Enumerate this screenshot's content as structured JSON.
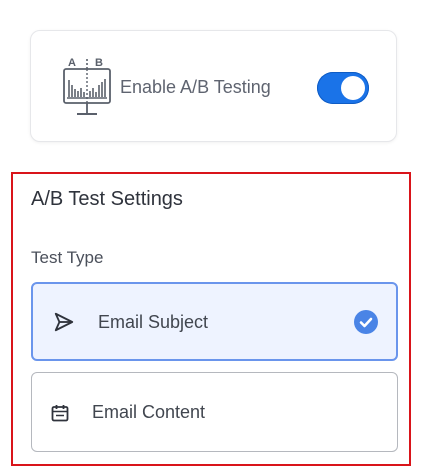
{
  "toggle_card": {
    "icon_letters": [
      "A",
      "B"
    ],
    "label": "Enable A/B Testing",
    "enabled": true,
    "accent_color": "#1a73e8"
  },
  "settings": {
    "title": "A/B Test Settings",
    "test_type_label": "Test Type",
    "options": [
      {
        "label": "Email Subject",
        "icon": "send-icon",
        "selected": true
      },
      {
        "label": "Email Content",
        "icon": "calendar-icon",
        "selected": false
      }
    ],
    "highlight_color": "#d9141a"
  }
}
